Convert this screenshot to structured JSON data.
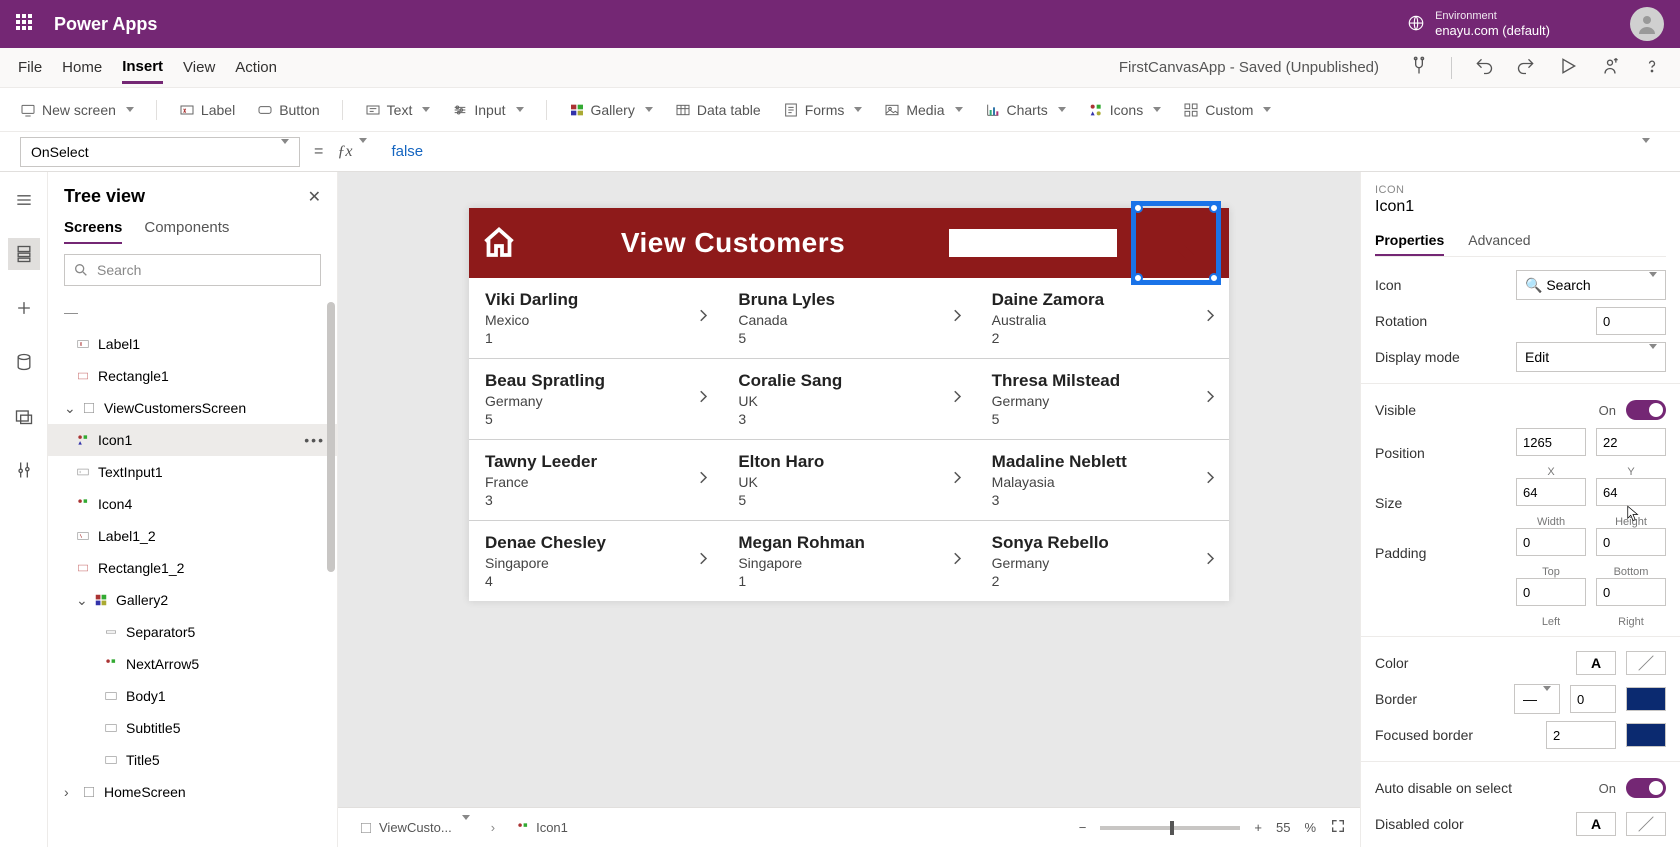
{
  "brand": "Power Apps",
  "environment": {
    "label": "Environment",
    "value": "enayu.com (default)"
  },
  "menu": {
    "file": "File",
    "home": "Home",
    "insert": "Insert",
    "view": "View",
    "action": "Action"
  },
  "appStatus": "FirstCanvasApp - Saved (Unpublished)",
  "ribbon": {
    "newScreen": "New screen",
    "label": "Label",
    "button": "Button",
    "text": "Text",
    "input": "Input",
    "gallery": "Gallery",
    "dataTable": "Data table",
    "forms": "Forms",
    "media": "Media",
    "charts": "Charts",
    "icons": "Icons",
    "custom": "Custom"
  },
  "formula": {
    "property": "OnSelect",
    "value": "false"
  },
  "tree": {
    "title": "Tree view",
    "tabs": {
      "screens": "Screens",
      "components": "Components"
    },
    "searchPlaceholder": "Search",
    "nodes": {
      "label1": "Label1",
      "rectangle1": "Rectangle1",
      "viewCustomers": "ViewCustomersScreen",
      "icon1": "Icon1",
      "textInput1": "TextInput1",
      "icon4": "Icon4",
      "label1_2": "Label1_2",
      "rectangle1_2": "Rectangle1_2",
      "gallery2": "Gallery2",
      "separator5": "Separator5",
      "nextArrow5": "NextArrow5",
      "body1": "Body1",
      "subtitle5": "Subtitle5",
      "title5": "Title5",
      "homeScreen": "HomeScreen"
    }
  },
  "canvas": {
    "headerTitle": "View Customers",
    "rows": [
      [
        {
          "name": "Viki  Darling",
          "country": "Mexico",
          "n": "1"
        },
        {
          "name": "Bruna  Lyles",
          "country": "Canada",
          "n": "5"
        },
        {
          "name": "Daine  Zamora",
          "country": "Australia",
          "n": "2"
        }
      ],
      [
        {
          "name": "Beau  Spratling",
          "country": "Germany",
          "n": "5"
        },
        {
          "name": "Coralie  Sang",
          "country": "UK",
          "n": "3"
        },
        {
          "name": "Thresa  Milstead",
          "country": "Germany",
          "n": "5"
        }
      ],
      [
        {
          "name": "Tawny  Leeder",
          "country": "France",
          "n": "3"
        },
        {
          "name": "Elton  Haro",
          "country": "UK",
          "n": "5"
        },
        {
          "name": "Madaline  Neblett",
          "country": "Malayasia",
          "n": "3"
        }
      ],
      [
        {
          "name": "Denae  Chesley",
          "country": "Singapore",
          "n": "4"
        },
        {
          "name": "Megan  Rohman",
          "country": "Singapore",
          "n": "1"
        },
        {
          "name": "Sonya  Rebello",
          "country": "Germany",
          "n": "2"
        }
      ]
    ]
  },
  "footer": {
    "bc1": "ViewCusto...",
    "bc2": "Icon1",
    "zoom": "55",
    "zoomUnit": "%"
  },
  "props": {
    "type": "ICON",
    "name": "Icon1",
    "tabs": {
      "properties": "Properties",
      "advanced": "Advanced"
    },
    "labels": {
      "icon": "Icon",
      "rotation": "Rotation",
      "displayMode": "Display mode",
      "visible": "Visible",
      "position": "Position",
      "size": "Size",
      "padding": "Padding",
      "color": "Color",
      "border": "Border",
      "focusedBorder": "Focused border",
      "autoDisable": "Auto disable on select",
      "disabledColor": "Disabled color",
      "x": "X",
      "y": "Y",
      "width": "Width",
      "height": "Height",
      "top": "Top",
      "bottom": "Bottom",
      "left": "Left",
      "right": "Right",
      "on": "On"
    },
    "values": {
      "iconValue": "Search",
      "rotation": "0",
      "displayMode": "Edit",
      "posX": "1265",
      "posY": "22",
      "width": "64",
      "height": "64",
      "padTop": "0",
      "padBottom": "0",
      "padLeft": "0",
      "padRight": "0",
      "borderWidth": "0",
      "focusedBorder": "2",
      "fontGlyph": "A"
    }
  }
}
